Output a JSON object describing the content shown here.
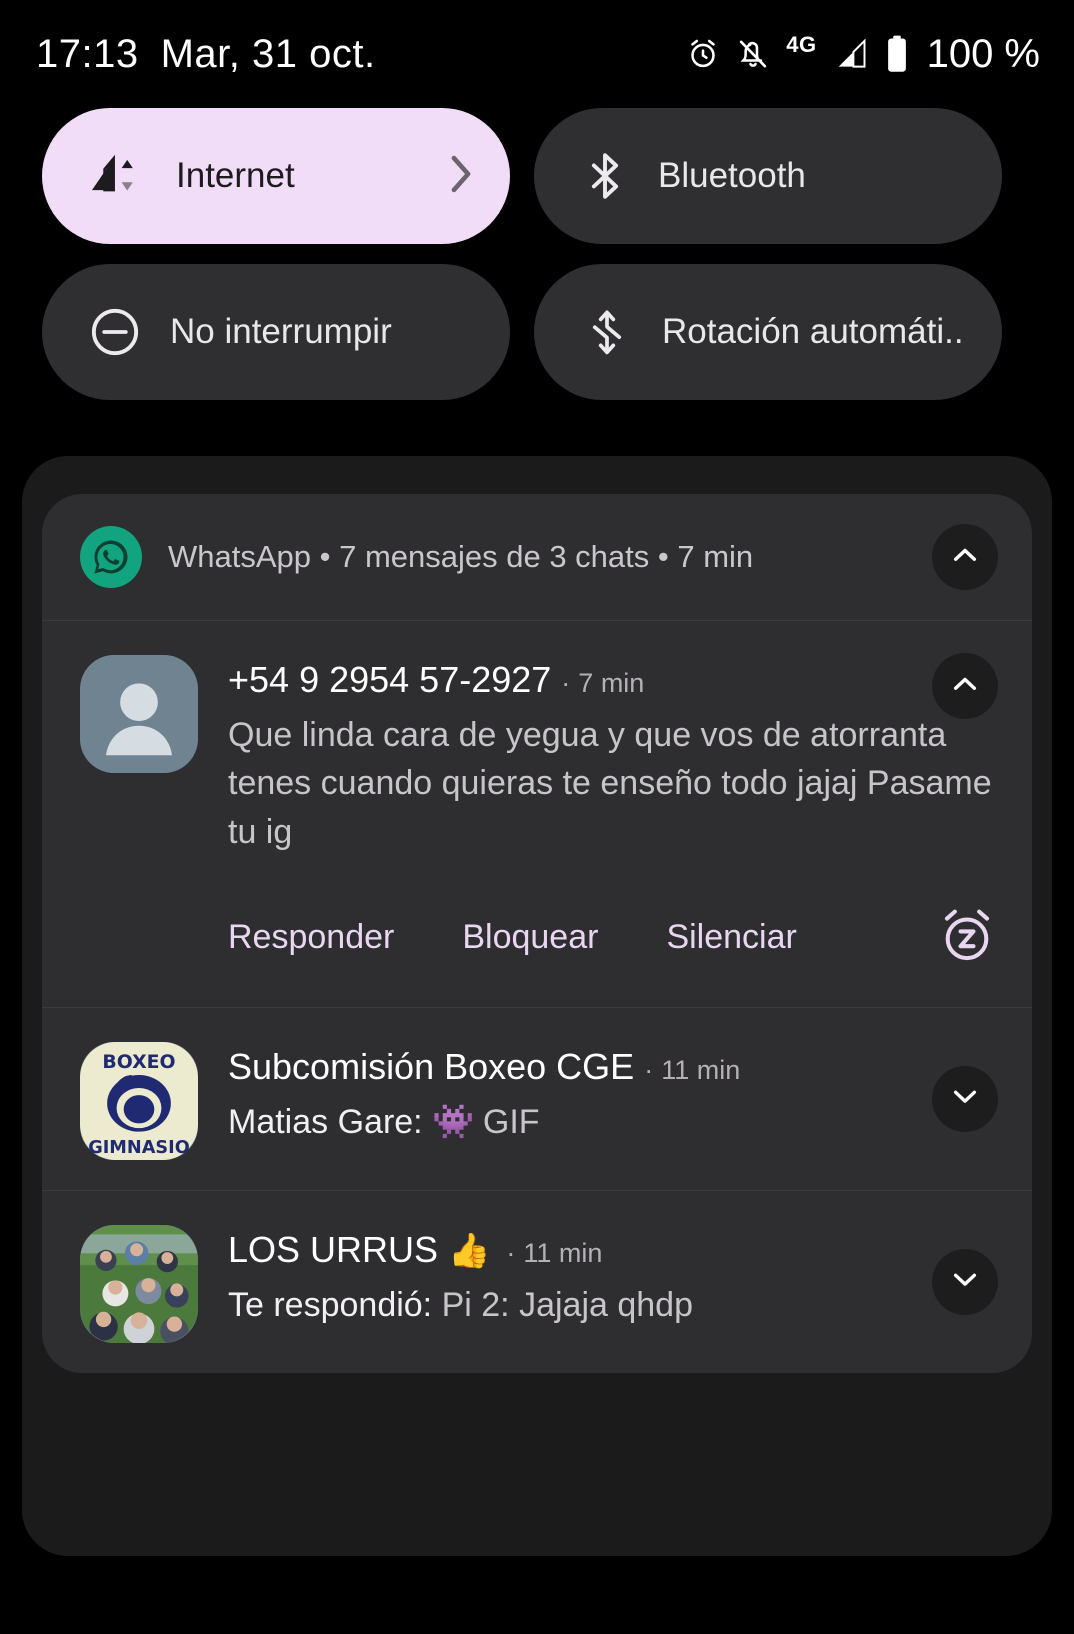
{
  "status_bar": {
    "time": "17:13",
    "date": "Mar, 31 oct.",
    "network_type": "4G",
    "battery_percent": "100 %",
    "icons": [
      "alarm-icon",
      "notifications-off-icon",
      "signal-icon",
      "battery-icon"
    ]
  },
  "quick_settings": {
    "tiles": [
      {
        "label": "Internet",
        "icon": "signal-cellular-icon",
        "state": "active",
        "has_chevron": true,
        "bg": "#f1ddf7",
        "fg": "#1d1b1e"
      },
      {
        "label": "Bluetooth",
        "icon": "bluetooth-icon",
        "state": "inactive",
        "has_chevron": false,
        "bg": "#2f2f31",
        "fg": "#e8e8e8"
      },
      {
        "label": "No interrumpir",
        "icon": "do-not-disturb-icon",
        "state": "inactive",
        "has_chevron": false,
        "bg": "#2f2f31",
        "fg": "#e8e8e8"
      },
      {
        "label": "Rotación automáti..",
        "icon": "auto-rotate-icon",
        "state": "inactive",
        "has_chevron": false,
        "bg": "#2f2f31",
        "fg": "#e8e8e8"
      }
    ]
  },
  "notification_group": {
    "app_name": "WhatsApp",
    "summary": "WhatsApp • 7 mensajes de 3 chats • 7 min",
    "app_icon": "whatsapp-icon",
    "collapse_icon": "chevron-up-icon",
    "notifications": [
      {
        "title": "+54 9 2954 57-2927",
        "time": "7 min",
        "message": "Que linda cara de yegua y que vos de atorranta tenes cuando quieras te enseño todo jajaj Pasame tu ig",
        "avatar": "default-contact-avatar",
        "expanded": true,
        "expand_icon": "chevron-up-icon",
        "actions": [
          "Responder",
          "Bloquear",
          "Silenciar"
        ],
        "snooze_icon": "snooze-alarm-icon"
      },
      {
        "title": "Subcomisión Boxeo CGE",
        "time": "11 min",
        "emoji": "",
        "message_lead": "Matias Gare:",
        "message_emoji": "👾",
        "message_rest": "GIF",
        "avatar": "boxeo-gimnasio-logo-avatar",
        "expanded": false,
        "expand_icon": "chevron-down-icon"
      },
      {
        "title": "LOS URRUS",
        "emoji": "👍",
        "time": "11 min",
        "message_lead": "Te respondió:",
        "message_rest": "Pi 2: Jajaja qhdp",
        "avatar": "group-photo-avatar",
        "expanded": false,
        "expand_icon": "chevron-down-icon"
      }
    ]
  },
  "colors": {
    "background": "#000000",
    "shade_background": "#1b1b1b",
    "card_background": "#2e2e30",
    "accent": "#e9d7f2",
    "active_tile": "#f1ddf7",
    "whatsapp_green": "#12a37f"
  }
}
